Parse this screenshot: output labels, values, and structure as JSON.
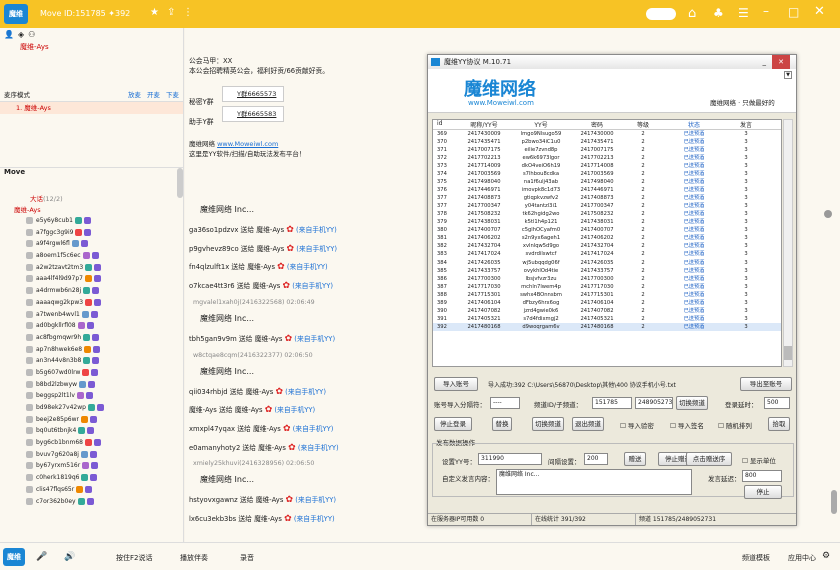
{
  "topbar": {
    "logo": "魔维",
    "title": "Move  ID:151785  ✦392",
    "edit": "编辑"
  },
  "left": {
    "owner": "魔维-Ays",
    "queue_title": "麦序模式",
    "queue_ops": [
      "放麦",
      "开麦",
      "下麦"
    ],
    "queue_item": "1. 魔维-Ays",
    "channel": "Move",
    "subroom": "大话",
    "subroom_count": "(12/2)",
    "admin": "魔维-Ays",
    "users": [
      "e5y6y8cub1",
      "a7fggc3g9i9",
      "a9f4rgwl6fl",
      "a8oem1f5c6ec",
      "a2w2tzavt2tm3",
      "aaa4lf4l9d97p7",
      "a4drmwb6n28j",
      "aaaaqwg2kpw3",
      "a7twenb4wvl1",
      "ad0bgkllrfl08",
      "ac8fbgmqwr9h",
      "ap7n8hwek6e8",
      "an3n44v8n3b8",
      "b5g607wd0lrw",
      "b8bd2lzbwyw",
      "beggsp2lt1lv",
      "bd98ek27v42wp",
      "beej2e85p6wr",
      "bq0ut6tbnjk4",
      "byg6cb1bnm68",
      "bvuv7g620a8j",
      "by67yrxm516r",
      "c0herk1819q6",
      "clis47flqs65r",
      "c7or362b0ey"
    ]
  },
  "chat": {
    "announce": [
      "公会马甲：XX",
      "本公会招聘精英公会，福利好贡/66贡献好贡。"
    ],
    "supporter1": "秘密Y群",
    "supporter2": "助手Y群",
    "link1": "Y群6665573",
    "link2": "Y群6665583",
    "site_label": "魔维网络",
    "site": "www.Moweiwl.com",
    "site_desc": "这里是YY软件/扫描/自助玩法发布平台！",
    "messages": [
      {
        "type": "head",
        "text": "魔维网络 Inc..."
      },
      {
        "type": "gift",
        "text": "ga36so1pdzvx 送给 魔维-Ays",
        "src": "(来自手机YY)"
      },
      {
        "type": "gift",
        "text": "p9gvhevz89co 送给 魔维-Ays",
        "src": "(来自手机YY)"
      },
      {
        "type": "gift",
        "text": "fn4qlzulft1x 送给 魔维-Ays",
        "src": "(来自手机YY)"
      },
      {
        "type": "gift",
        "text": "o7kcae4tt3r6 送给 魔维-Ays",
        "src": "(来自手机YY)"
      },
      {
        "type": "time",
        "text": "mgvalel1xah0j(2416322568) 02:06:49"
      },
      {
        "type": "head",
        "text": "魔维网络 Inc..."
      },
      {
        "type": "gift",
        "text": "tbh5gan9v9m 送给 魔维-Ays",
        "src": "(来自手机YY)"
      },
      {
        "type": "time",
        "text": "w8ctqae8cqm(2416322377) 02:06:50"
      },
      {
        "type": "head",
        "text": "魔维网络 Inc..."
      },
      {
        "type": "gift",
        "text": "qii034rhbjd 送给 魔维-Ays",
        "src": "(来自手机YY)"
      },
      {
        "type": "gift",
        "text": "魔维-Ays 送给 魔维-Ays",
        "src": "(来自手机YY)"
      },
      {
        "type": "gift",
        "text": "xmxpl47yqax 送给 魔维-Ays",
        "src": "(来自手机YY)"
      },
      {
        "type": "gift",
        "text": "e0amanyhoty2 送给 魔维-Ays",
        "src": "(来自手机YY)"
      },
      {
        "type": "time",
        "text": "xmiely25khuvi(2416328956) 02:06:50"
      },
      {
        "type": "head",
        "text": "魔维网络 Inc..."
      },
      {
        "type": "gift",
        "text": "hstyovxgawnz 送给 魔维-Ays",
        "src": "(来自手机YY)"
      },
      {
        "type": "gift",
        "text": "lx6cu3ekb3bs 送给 魔维-Ays",
        "src": "(来自手机YY)"
      }
    ]
  },
  "win": {
    "title": "魔维YY协议 M.10.71",
    "brand": "魔维网络",
    "brand_url": "www.Moweiwl.com",
    "tagline": "魔维网络 · 只做最好的",
    "headers": [
      "id",
      "昵称/YY号",
      "YY号",
      "密码",
      "等级",
      "状态",
      "发言"
    ],
    "rows": [
      [
        "369",
        "2417430009",
        "lmgo9Nlsugo59",
        "2417430000",
        "2",
        "已送预酒",
        "3"
      ],
      [
        "370",
        "2417435471",
        "p2bwo34iC1u0",
        "2417435471",
        "2",
        "已送预酒",
        "3"
      ],
      [
        "371",
        "2417007175",
        "eilie7zvnd8p",
        "2417007175",
        "2",
        "已送预酒",
        "3"
      ],
      [
        "372",
        "2417702213",
        "ew6k6973lgor",
        "2417702213",
        "2",
        "已送预酒",
        "3"
      ],
      [
        "373",
        "2417714009",
        "dkO4veiO6h19",
        "2417714008",
        "2",
        "已送预酒",
        "3"
      ],
      [
        "374",
        "2417003569",
        "s7lhbou8cdka",
        "2417003569",
        "2",
        "已送预酒",
        "3"
      ],
      [
        "375",
        "2417498040",
        "na1f6ulj43ab",
        "2417498040",
        "2",
        "已送预酒",
        "3"
      ],
      [
        "376",
        "2417446971",
        "imovpk8c1d73",
        "2417446971",
        "2",
        "已送预酒",
        "3"
      ],
      [
        "377",
        "2417408873",
        "gtiqpkvzwfv2",
        "2417408873",
        "2",
        "已送预酒",
        "3"
      ],
      [
        "377",
        "2417700347",
        "y04tantzl3i1",
        "2417700347",
        "2",
        "已送预酒",
        "3"
      ],
      [
        "378",
        "2417508232",
        "tk62hgidg2wo",
        "2417508232",
        "2",
        "已送预酒",
        "3"
      ],
      [
        "379",
        "2417438031",
        "k5tl1h4p121",
        "2417438031",
        "2",
        "已送预酒",
        "3"
      ],
      [
        "380",
        "2417400707",
        "c5glhOCyafm0",
        "2417400707",
        "2",
        "已送预酒",
        "3"
      ],
      [
        "381",
        "2417406202",
        "s2n9yx6ageh1",
        "2417406202",
        "2",
        "已送预酒",
        "3"
      ],
      [
        "382",
        "2417432704",
        "xvlnlqw5d9go",
        "2417432704",
        "2",
        "已送预酒",
        "3"
      ],
      [
        "383",
        "2417417024",
        "svdrdilswtcf",
        "2417417024",
        "2",
        "已送预酒",
        "3"
      ],
      [
        "384",
        "2417426035",
        "wj5ubqqdg06f",
        "2417426035",
        "2",
        "已送预酒",
        "3"
      ],
      [
        "385",
        "2417433757",
        "ovykhlOd4tie",
        "2417433757",
        "2",
        "已送预酒",
        "3"
      ],
      [
        "386",
        "2417700300",
        "lbsjvfvzr3zu",
        "2417700300",
        "2",
        "已送预酒",
        "3"
      ],
      [
        "387",
        "2417717030",
        "mchln7lwem4p",
        "2417717030",
        "2",
        "已送预酒",
        "3"
      ],
      [
        "388",
        "2417715301",
        "swhx4BOnnsbm",
        "2417715301",
        "2",
        "已送预酒",
        "3"
      ],
      [
        "389",
        "2417406104",
        "dFbzy6hrx6og",
        "2417406104",
        "2",
        "已送预酒",
        "3"
      ],
      [
        "390",
        "2417407082",
        "jzrd4gwie0k6",
        "2417407082",
        "2",
        "已送预酒",
        "3"
      ],
      [
        "391",
        "2417405321",
        "s7d4fdixmgj2",
        "2417405321",
        "2",
        "已送预酒",
        "3"
      ],
      [
        "392",
        "2417480168",
        "d9woqrgam6v",
        "2417480168",
        "2",
        "已送预酒",
        "3"
      ]
    ],
    "import_btn": "导入账号",
    "import_path": "导入成功:392 C:\\Users\\56870\\Desktop\\其他\\400 协议手机小号.txt",
    "export_btn": "导出至账号",
    "account_label": "账号导入分隔符：",
    "sep": "----",
    "channel_label": "频道ID/子频道：",
    "ch1": "151785",
    "ch2": "2489052731",
    "switch_btn": "切换频道",
    "interval_label": "登录延时：",
    "interval": "500",
    "stop_login": "停止登录",
    "keepalive": "替换",
    "switch_ch": "切换频道",
    "exit_ch": "退出频道",
    "cb1": "导入验密",
    "cb2": "导入签名",
    "cb3": "随机排列",
    "fetch": "拾取",
    "section": "发布数据操作",
    "set_label": "设置YY号：",
    "set_val": "311990",
    "gap_label": "间隔设置：",
    "gap": "200",
    "btn_send": "赠送",
    "btn_stop": "停止赠送",
    "btn_hold": "点击赠送序",
    "cb_show": "显示单位",
    "msg_label": "自定义发言内容：",
    "msg_val": "魔维网络 Inc...",
    "speak_label": "发言延迟：",
    "speak_val": "800",
    "stop_btn": "停止",
    "status": [
      "在服务器IP可用数  0",
      "在线统计  391/392",
      "频道  151785/2489052731"
    ]
  },
  "bottom": {
    "logo": "魔维",
    "voice": "按住F2说话",
    "play": "播放伴奏",
    "mic": "录音",
    "mode": "频道模板",
    "apps": "应用中心"
  }
}
